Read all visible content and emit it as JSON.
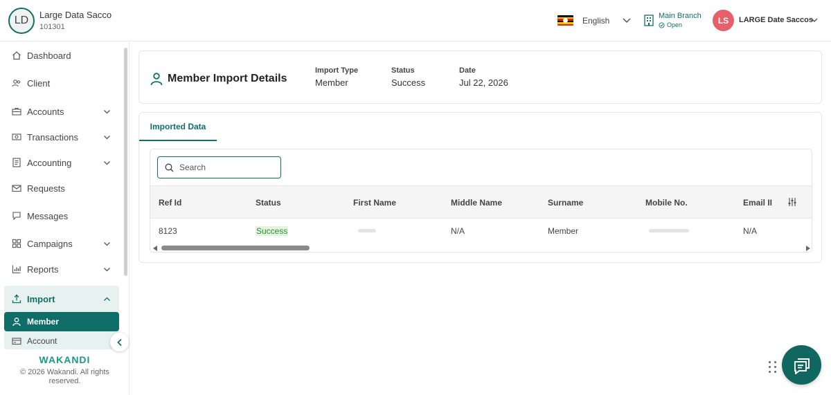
{
  "org": {
    "initials": "LD",
    "name": "Large Data Sacco",
    "code": "101301"
  },
  "header": {
    "language": "English",
    "branch": {
      "name": "Main Branch",
      "status": "Open"
    },
    "user": {
      "initials": "LS",
      "name": "LARGE Date Saccos"
    }
  },
  "sidebar": {
    "items": [
      {
        "label": "Dashboard"
      },
      {
        "label": "Client"
      },
      {
        "label": "Accounts"
      },
      {
        "label": "Transactions"
      },
      {
        "label": "Accounting"
      },
      {
        "label": "Requests"
      },
      {
        "label": "Messages"
      },
      {
        "label": "Campaigns"
      },
      {
        "label": "Reports"
      }
    ],
    "import": {
      "label": "Import",
      "sub": [
        {
          "label": "Member"
        },
        {
          "label": "Account"
        }
      ]
    },
    "brand": "WAKANDI",
    "copyright": "© 2026 Wakandi. All rights reserved."
  },
  "details": {
    "title": "Member Import Details",
    "import_type_label": "Import Type",
    "import_type": "Member",
    "status_label": "Status",
    "status": "Success",
    "date_label": "Date",
    "date": "Jul 22, 2026"
  },
  "tabs": {
    "imported": "Imported Data"
  },
  "table": {
    "search_placeholder": "Search",
    "columns": [
      "Ref Id",
      "Status",
      "First Name",
      "Middle Name",
      "Surname",
      "Mobile No.",
      "Email II"
    ],
    "rows": [
      {
        "ref_id": "8123",
        "status": "Success",
        "middle_name": "N/A",
        "surname": "Member",
        "email": "N/A"
      }
    ]
  },
  "colors": {
    "primary": "#0f6e68",
    "avatar": "#e6606a",
    "success_bg": "#e3f5df",
    "success_text": "#2e8b3e"
  }
}
